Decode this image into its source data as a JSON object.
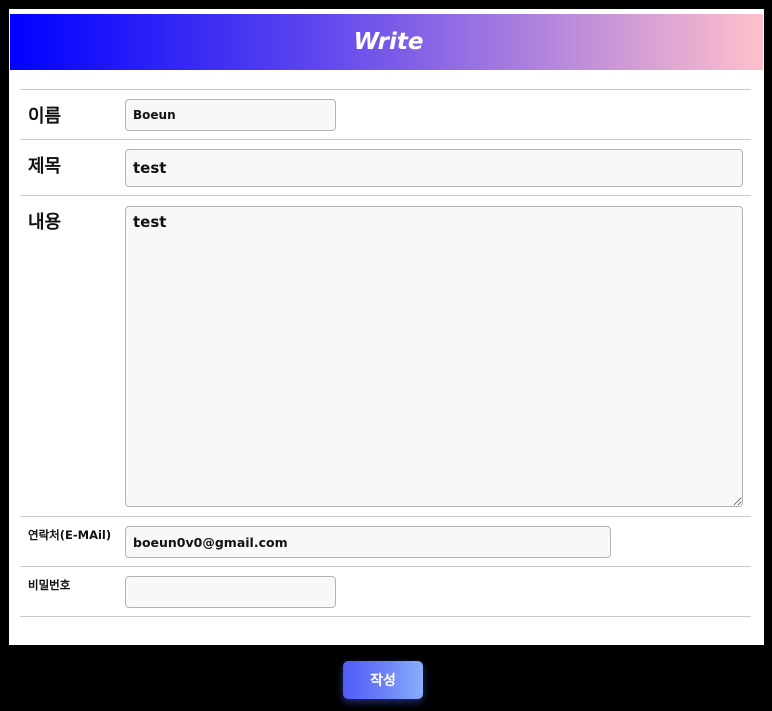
{
  "header": {
    "title": "Write"
  },
  "form": {
    "name": {
      "label": "이름",
      "value": "Boeun"
    },
    "subject": {
      "label": "제목",
      "value": "test"
    },
    "content": {
      "label": "내용",
      "value": "test"
    },
    "email": {
      "label": "연락처(E-MAil)",
      "value": "boeun0v0@gmail.com"
    },
    "password": {
      "label": "비밀번호",
      "value": ""
    }
  },
  "submit": {
    "label": "작성"
  },
  "colors": {
    "background": "#000000",
    "header_gradient_start": "#0000ff",
    "header_gradient_end": "#ffc0cb",
    "button_gradient_start": "#4f5cf5",
    "button_gradient_end": "#88b0f9"
  }
}
